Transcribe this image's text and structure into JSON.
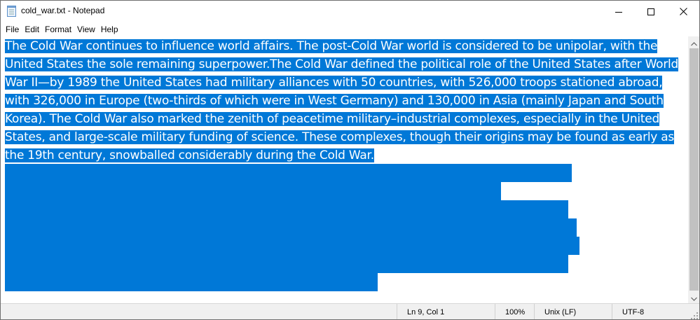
{
  "window": {
    "title": "cold_war.txt - Notepad",
    "icons": {
      "app": "notepad-icon",
      "minimize": "minimize-icon",
      "maximize": "maximize-icon",
      "close": "close-icon"
    }
  },
  "menu": [
    {
      "label": "File"
    },
    {
      "label": "Edit"
    },
    {
      "label": "Format"
    },
    {
      "label": "View"
    },
    {
      "label": "Help"
    }
  ],
  "editor": {
    "text": "The Cold War continues to influence world affairs. The post-Cold War world is considered to be unipolar, with the United States the sole remaining superpower.The Cold War defined the political role of the United States after World War II—by 1989 the United States had military alliances with 50 countries, with 526,000 troops stationed abroad, with 326,000 in Europe (two-thirds of which were in West Germany) and 130,000 in Asia (mainly Japan and South Korea). The Cold War also marked the zenith of peacetime military–industrial complexes, especially in the United States, and large-scale military funding of science. These complexes, though their origins may be found as early as the 19th century, snowballed considerably during the Cold War.",
    "selection_color": "#0078d7"
  },
  "status": {
    "position": "Ln 9, Col 1",
    "zoom": "100%",
    "line_ending": "Unix (LF)",
    "encoding": "UTF-8"
  }
}
